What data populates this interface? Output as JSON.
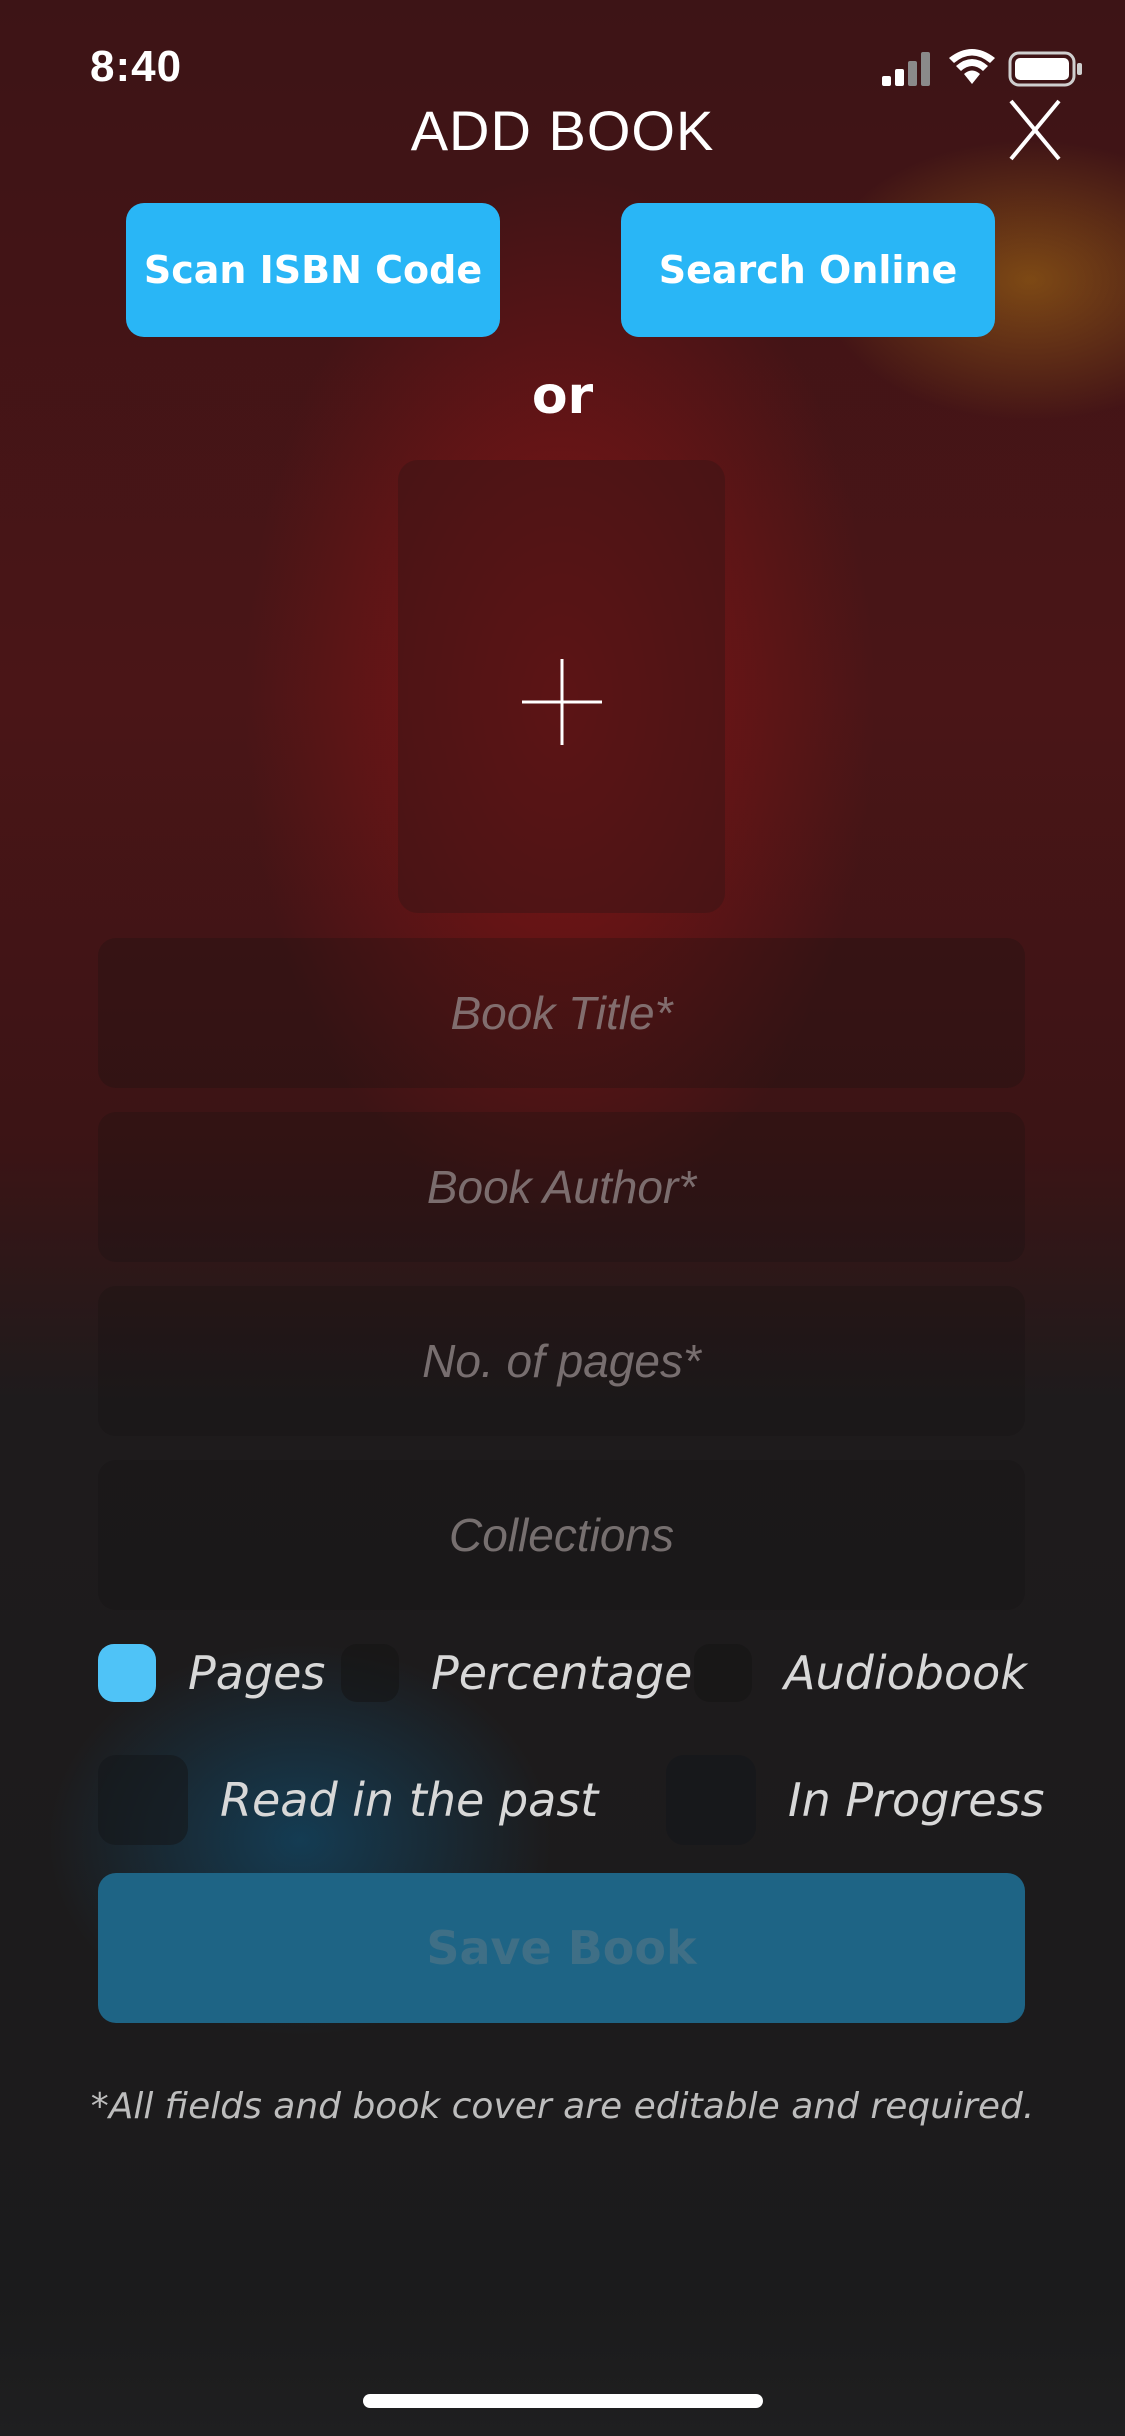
{
  "status_bar": {
    "time": "8:40"
  },
  "header": {
    "title": "ADD BOOK"
  },
  "actions": {
    "scan_label": "Scan ISBN Code",
    "search_label": "Search Online",
    "or_label": "or"
  },
  "fields": {
    "title_placeholder": "Book Title*",
    "author_placeholder": "Book Author*",
    "pages_placeholder": "No. of pages*",
    "collections_placeholder": "Collections"
  },
  "progress_type": {
    "options": [
      "Pages",
      "Percentage",
      "Audiobook"
    ],
    "selected": "Pages"
  },
  "status_options": {
    "read_past": "Read in the past",
    "in_progress": "In Progress"
  },
  "save_label": "Save Book",
  "footnote": "*All fields and book cover are editable and required.",
  "colors": {
    "accent": "#29b6f6",
    "save_button": "#1e6485",
    "selected_radio": "#4fc3f7"
  },
  "icons": [
    "signal-icon",
    "wifi-icon",
    "battery-icon",
    "close-icon",
    "plus-icon"
  ]
}
